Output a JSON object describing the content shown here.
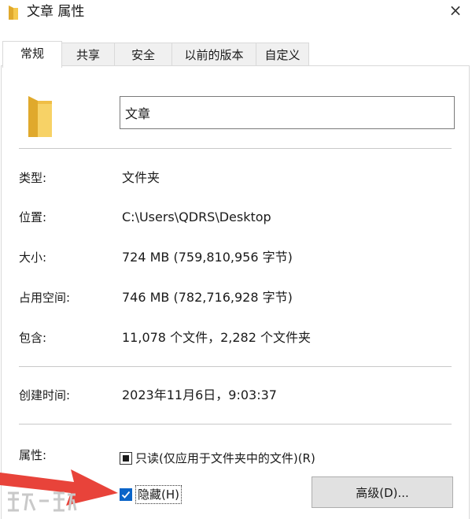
{
  "window": {
    "title": "文章 属性",
    "close_glyph": "×"
  },
  "tabs": [
    {
      "label": "常规",
      "active": true
    },
    {
      "label": "共享",
      "active": false
    },
    {
      "label": "安全",
      "active": false
    },
    {
      "label": "以前的版本",
      "active": false
    },
    {
      "label": "自定义",
      "active": false
    }
  ],
  "general": {
    "folder_name": "文章",
    "type_label": "类型:",
    "type_value": "文件夹",
    "location_label": "位置:",
    "location_value": "C:\\Users\\QDRS\\Desktop",
    "size_label": "大小:",
    "size_value": "724 MB (759,810,956 字节)",
    "disk_size_label": "占用空间:",
    "disk_size_value": "746 MB (782,716,928 字节)",
    "contains_label": "包含:",
    "contains_value": "11,078 个文件，2,282 个文件夹",
    "created_label": "创建时间:",
    "created_value": "2023年11月6日，9:03:37",
    "attributes_label": "属性:",
    "readonly_label": "只读(仅应用于文件夹中的文件)(R)",
    "readonly_state": "indeterminate",
    "hidden_label": "隐藏(H)",
    "hidden_checked": true,
    "advanced_button": "高级(D)..."
  },
  "icons": {
    "title_icon": "folder-icon",
    "big_icon": "folder-icon",
    "overlay_arrow": "red-arrow-icon",
    "watermark": "watermark-logo"
  },
  "colors": {
    "folder": "#f5c84c",
    "folder_dark": "#e0a92c",
    "check_blue": "#0a64c8",
    "arrow_red": "#e8433a",
    "watermark": "#c9c9c9"
  }
}
